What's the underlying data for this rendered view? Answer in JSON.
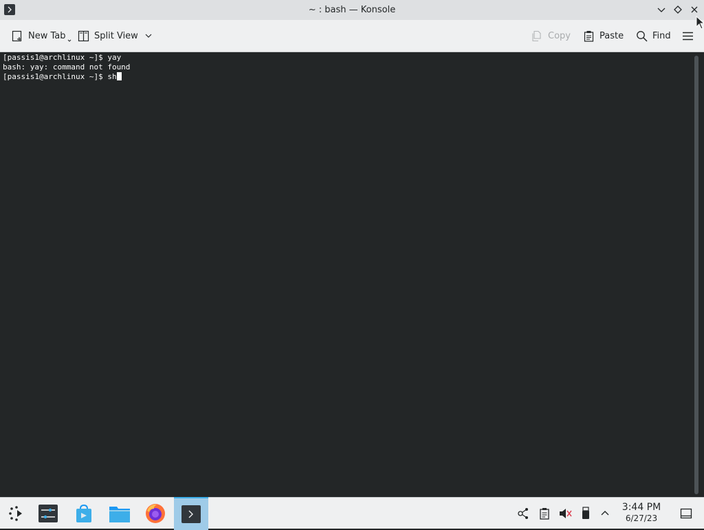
{
  "window": {
    "title": "~ : bash — Konsole",
    "icon": "terminal-icon"
  },
  "toolbar": {
    "new_tab": "New Tab",
    "split_view": "Split View",
    "copy": "Copy",
    "paste": "Paste",
    "find": "Find"
  },
  "terminal": {
    "lines": [
      "[passis1@archlinux ~]$ yay",
      "bash: yay: command not found",
      "[passis1@archlinux ~]$ sh"
    ]
  },
  "taskbar": {
    "apps": [
      "application-launcher-icon",
      "system-settings-icon",
      "discover-store-icon",
      "dolphin-file-manager-icon",
      "firefox-icon",
      "konsole-icon"
    ],
    "tray": [
      "kde-connect-icon",
      "clipboard-icon",
      "volume-muted-icon",
      "usb-device-icon",
      "tray-expand-icon"
    ],
    "time": "3:44 PM",
    "date": "6/27/23"
  },
  "colors": {
    "terminal_bg": "#232627",
    "terminal_fg": "#fcfcfc",
    "titlebar_bg": "#dee0e2",
    "panel_bg": "#eff0f1",
    "accent": "#3daee9"
  }
}
